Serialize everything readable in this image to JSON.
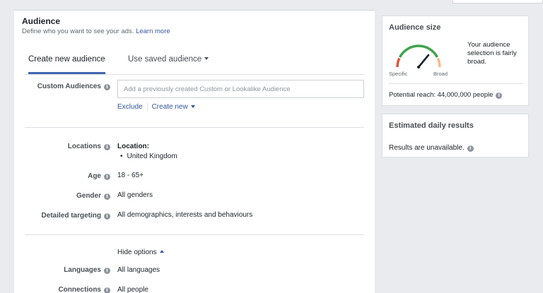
{
  "audience": {
    "title": "Audience",
    "subtitle": "Define who you want to see your ads.",
    "learn_more": "Learn more",
    "tabs": {
      "create": "Create new audience",
      "saved": "Use saved audience"
    },
    "custom_audiences": {
      "label": "Custom Audiences",
      "placeholder": "Add a previously created Custom or Lookalike Audience",
      "exclude": "Exclude",
      "create_new": "Create new"
    },
    "locations": {
      "label": "Locations",
      "heading": "Location:",
      "items": [
        "United Kingdom"
      ]
    },
    "age": {
      "label": "Age",
      "value": "18 - 65+"
    },
    "gender": {
      "label": "Gender",
      "value": "All genders"
    },
    "detailed_targeting": {
      "label": "Detailed targeting",
      "value": "All demographics, interests and behaviours"
    },
    "hide_options": "Hide options",
    "languages": {
      "label": "Languages",
      "value": "All languages"
    },
    "connections": {
      "label": "Connections",
      "value": "All people"
    }
  },
  "audience_size": {
    "title": "Audience size",
    "description": "Your audience selection is fairly broad.",
    "specific_label": "Specific",
    "broad_label": "Broad",
    "gauge_level": 0.72,
    "potential_reach": "Potential reach: 44,000,000 people"
  },
  "estimated": {
    "title": "Estimated daily results",
    "results": "Results are unavailable."
  },
  "colors": {
    "link": "#365899",
    "tab_active": "#4267b2",
    "gauge_red": "#e0533b",
    "gauge_green": "#3fa34d",
    "gauge_orange": "#f7b98b"
  }
}
